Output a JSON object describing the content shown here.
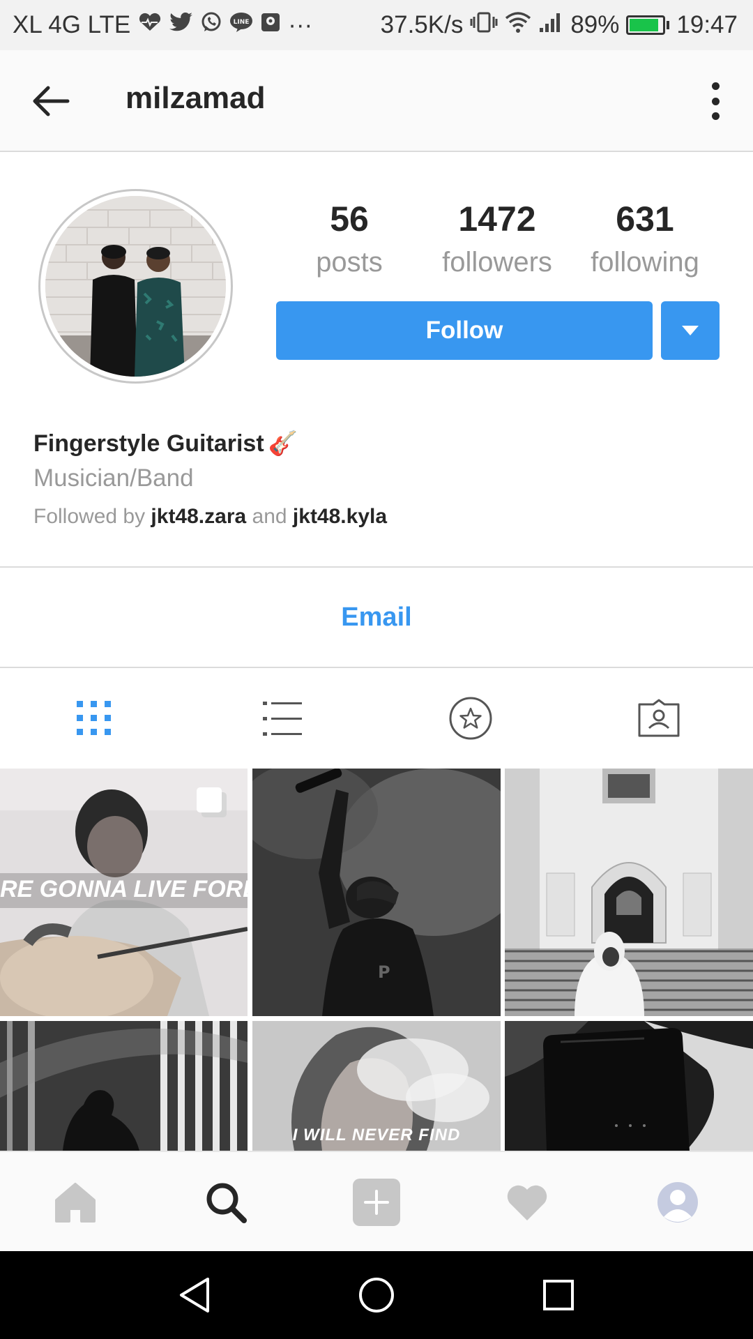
{
  "status_bar": {
    "carrier": "XL 4G LTE",
    "overflow": "···",
    "net_speed": "37.5K/s",
    "battery": "89%",
    "battery_level": 0.89,
    "time": "19:47"
  },
  "header": {
    "username": "milzamad"
  },
  "profile": {
    "stats": [
      {
        "value": "56",
        "label": "posts"
      },
      {
        "value": "1472",
        "label": "followers"
      },
      {
        "value": "631",
        "label": "following"
      }
    ],
    "follow_label": "Follow",
    "name": "Fingerstyle Guitarist",
    "name_emoji": "🎸",
    "category": "Musician/Band",
    "followed_by_prefix": "Followed by ",
    "followed_by_user1": "jkt48.zara",
    "followed_by_and": " and ",
    "followed_by_user2": "jkt48.kyla"
  },
  "contact": {
    "email_label": "Email"
  },
  "tabs": [
    {
      "icon": "grid-icon",
      "active": true
    },
    {
      "icon": "list-icon",
      "active": false
    },
    {
      "icon": "star-icon",
      "active": false
    },
    {
      "icon": "tagged-icon",
      "active": false
    }
  ],
  "posts": [
    {
      "overlay_text": "RE GONNA LIVE FOREVER I",
      "multi": true
    },
    {
      "overlay_text": "",
      "multi": false
    },
    {
      "overlay_text": "",
      "multi": false
    },
    {
      "overlay_text": "",
      "multi": false
    },
    {
      "overlay_text": "I WILL NEVER FIND",
      "multi": false
    },
    {
      "overlay_text": "",
      "multi": false
    }
  ],
  "bottom_nav": [
    "home-icon",
    "search-icon",
    "add-post-icon",
    "activity-icon",
    "profile-icon"
  ],
  "colors": {
    "accent": "#3897f0",
    "text": "#262626",
    "muted": "#999999",
    "divider": "#dbdbdb"
  }
}
